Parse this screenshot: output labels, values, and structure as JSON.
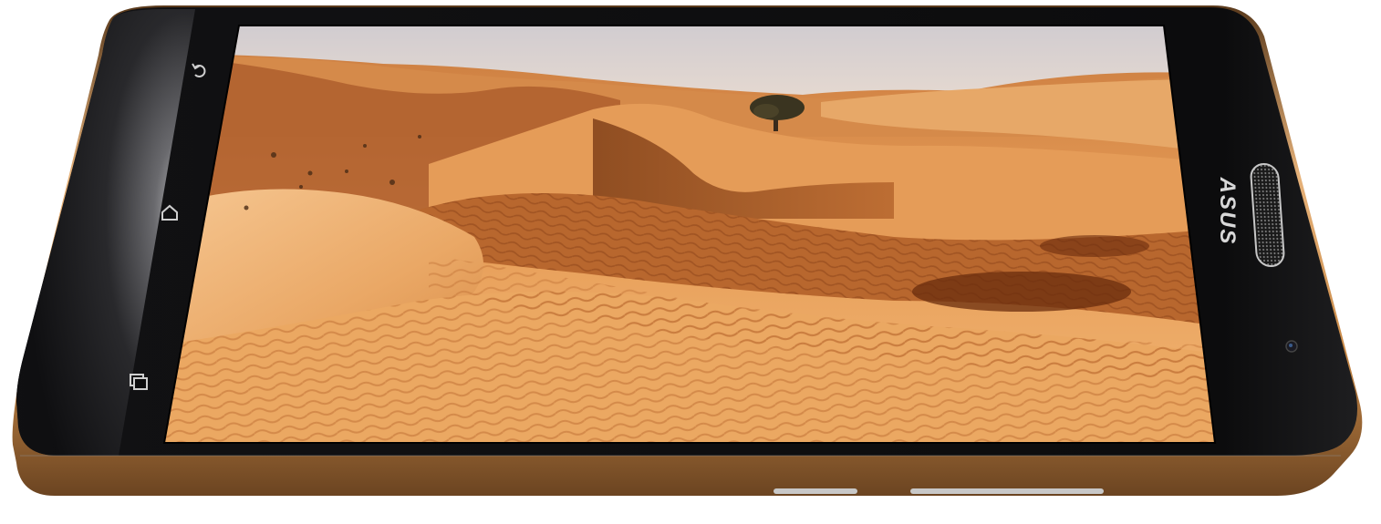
{
  "device": {
    "brand_logo": "ASUS",
    "body_color": "#c88a48",
    "glass_color": "#0b0b0c",
    "accent_gold": "#e0a868"
  },
  "nav_buttons": [
    {
      "name": "back",
      "icon": "back-arrow-icon"
    },
    {
      "name": "home",
      "icon": "home-icon"
    },
    {
      "name": "recent-apps",
      "icon": "recent-apps-icon"
    }
  ],
  "screen": {
    "content": "desert-dunes-photo",
    "sky_color": "#d8d4d4",
    "sand_light": "#f0b070",
    "sand_mid": "#d98a44",
    "sand_dark": "#9a4e1c"
  }
}
